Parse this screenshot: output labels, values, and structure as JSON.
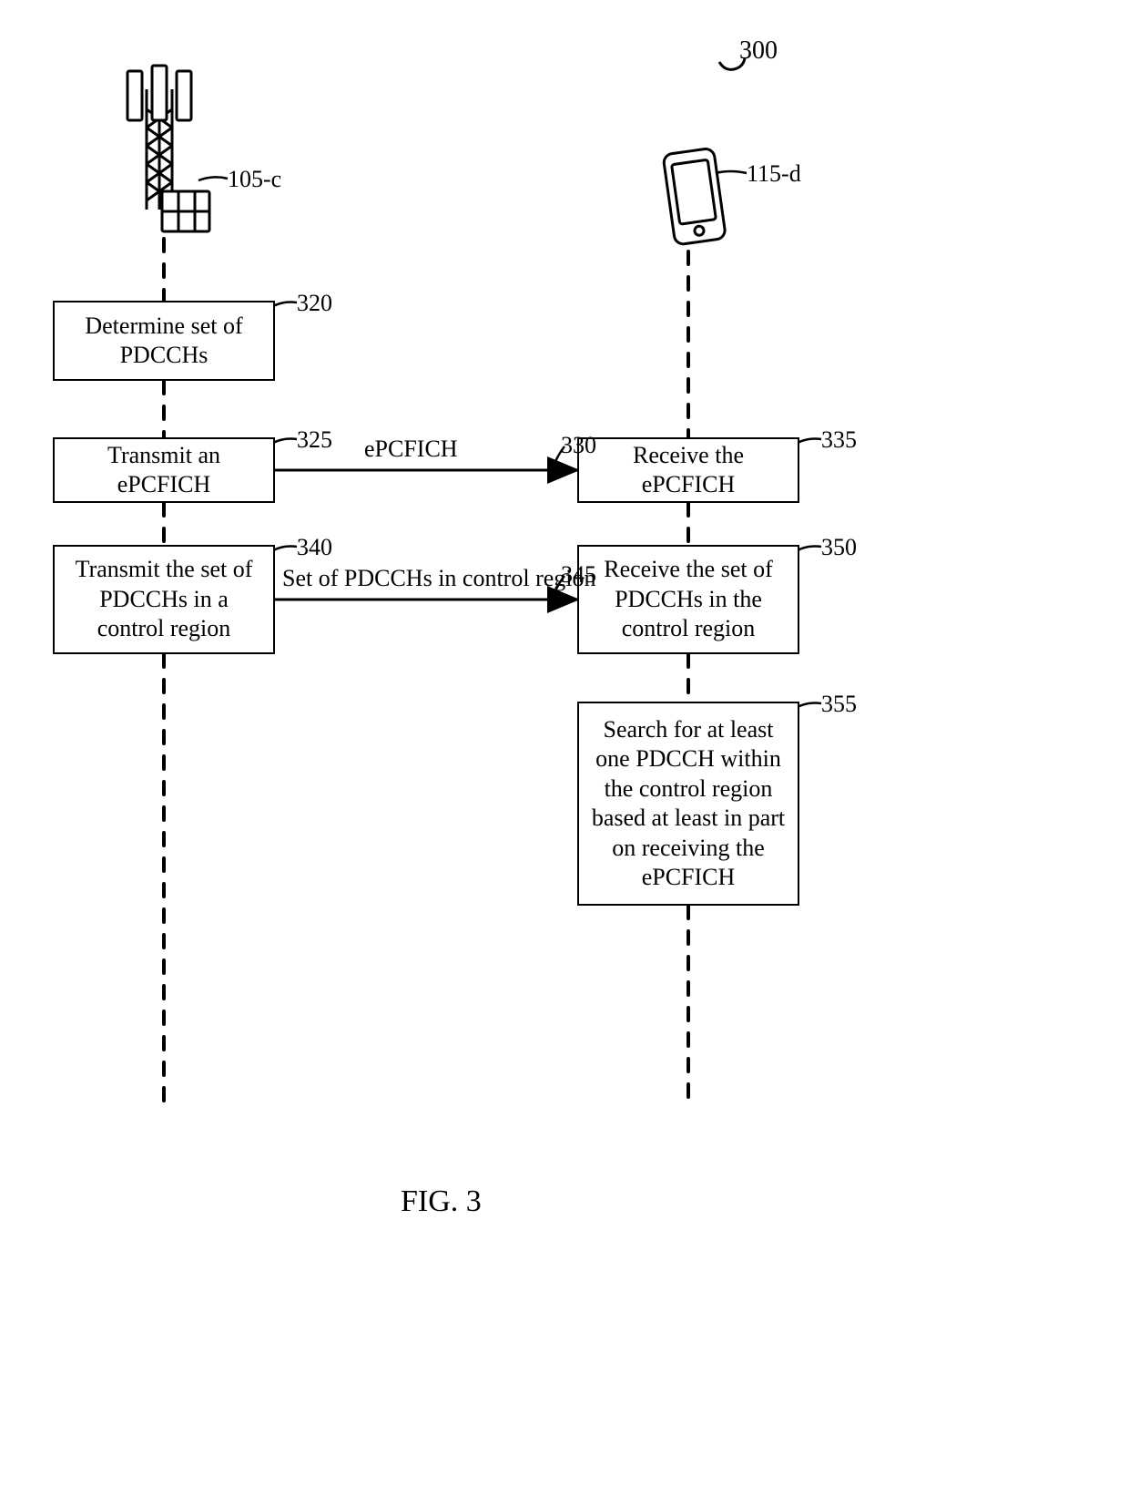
{
  "figure": {
    "number_label": "300",
    "caption": "FIG. 3"
  },
  "actors": {
    "left_label": "105-c",
    "right_label": "115-d"
  },
  "steps": {
    "left1": {
      "text": "Determine set of PDCCHs",
      "ref": "320"
    },
    "left2": {
      "text": "Transmit an ePCFICH",
      "ref": "325"
    },
    "left3": {
      "text": "Transmit the set of PDCCHs in a control region",
      "ref": "340"
    },
    "right2": {
      "text": "Receive the ePCFICH",
      "ref": "335"
    },
    "right3": {
      "text": "Receive the set of PDCCHs in the control region",
      "ref": "350"
    },
    "right4": {
      "text": "Search for at least one PDCCH within the control region based at least in part on receiving the ePCFICH",
      "ref": "355"
    }
  },
  "messages": {
    "m1": {
      "label": "ePCFICH",
      "ref": "330"
    },
    "m2": {
      "label": "Set of PDCCHs in control region",
      "ref": "345"
    }
  }
}
